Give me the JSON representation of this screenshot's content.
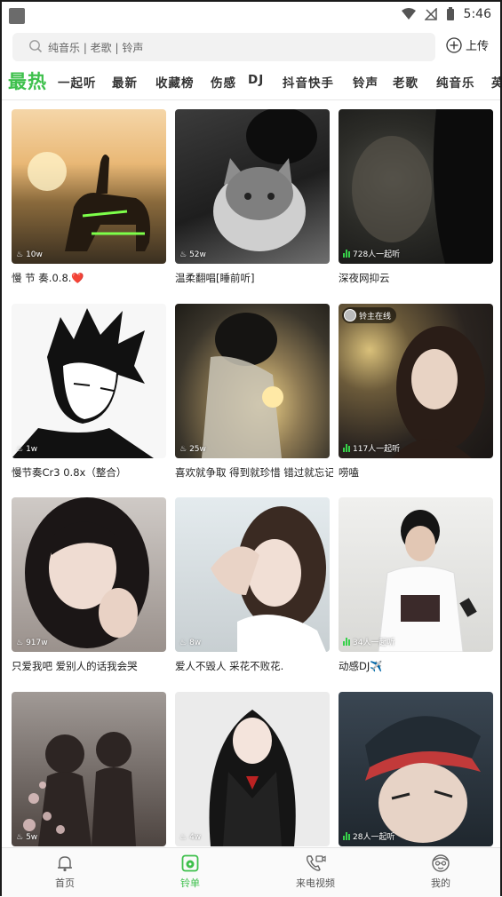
{
  "status": {
    "time": "5:46"
  },
  "search": {
    "placeholder": "纯音乐 | 老歌 | 铃声",
    "upload_label": "上传"
  },
  "tabs": [
    "最热",
    "一起听",
    "最新",
    "收藏榜",
    "伤感",
    "DJ",
    "抖音快手",
    "铃声",
    "老歌",
    "纯音乐",
    "英"
  ],
  "active_tab": 0,
  "cards": [
    {
      "title": "慢 节 奏.0.8.❤️",
      "stat": "10w",
      "stat_type": "plays"
    },
    {
      "title": "温柔翻唱[睡前听]",
      "stat": "52w",
      "stat_type": "plays"
    },
    {
      "title": "深夜网抑云",
      "stat": "728人一起听",
      "stat_type": "listening"
    },
    {
      "title": "慢节奏Cr3  0.8x（整合）",
      "stat": "1w",
      "stat_type": "plays"
    },
    {
      "title": "喜欢就争取 得到就珍惜 错过就忘记",
      "stat": "25w",
      "stat_type": "plays"
    },
    {
      "title": "唠嗑",
      "stat": "117人一起听",
      "stat_type": "listening",
      "badge": "铃主在线"
    },
    {
      "title": "只爱我吧 爱别人的话我会哭",
      "stat": "917w",
      "stat_type": "plays"
    },
    {
      "title": "爱人不毁人 采花不败花.",
      "stat": "8w",
      "stat_type": "plays"
    },
    {
      "title": "动感DJ✈️",
      "stat": "34人一起听",
      "stat_type": "listening"
    },
    {
      "title": "",
      "stat": "5w",
      "stat_type": "plays"
    },
    {
      "title": "",
      "stat": "4w",
      "stat_type": "plays"
    },
    {
      "title": "",
      "stat": "28人一起听",
      "stat_type": "listening"
    }
  ],
  "bottom_nav": [
    {
      "label": "首页",
      "icon": "bell-icon",
      "active": false
    },
    {
      "label": "铃单",
      "icon": "playlist-icon",
      "active": true
    },
    {
      "label": "来电视频",
      "icon": "phone-video-icon",
      "active": false
    },
    {
      "label": "我的",
      "icon": "profile-icon",
      "active": false
    }
  ],
  "colors": {
    "accent": "#3ec04c",
    "listening_bars": "#37d14a"
  }
}
